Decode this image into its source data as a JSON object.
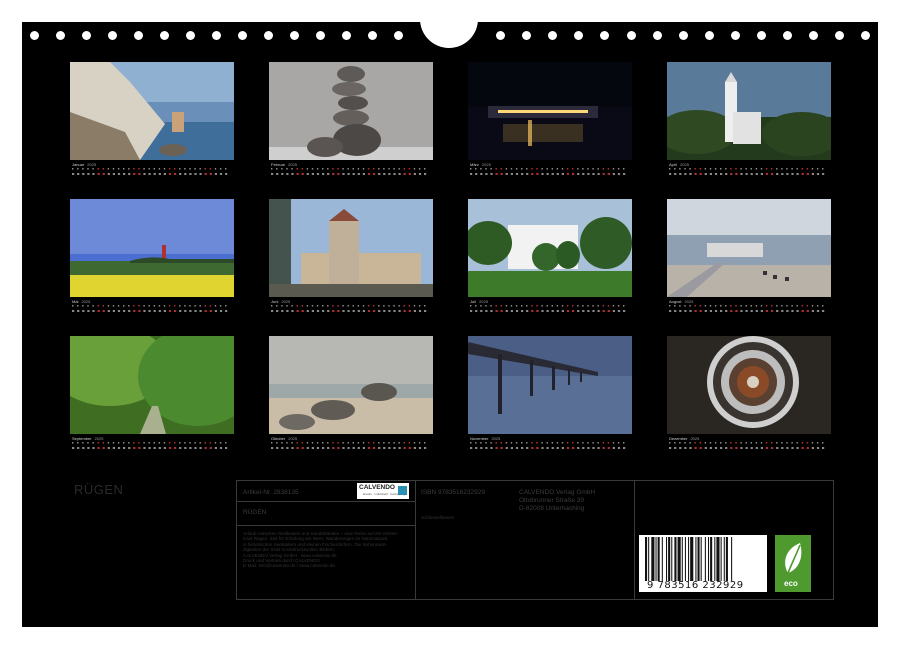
{
  "calendar": {
    "cover_title": "RÜGEN",
    "months": [
      {
        "name": "Januar",
        "year": "2025",
        "scene": "chalk-cliffs"
      },
      {
        "name": "Februar",
        "year": "2025",
        "scene": "stone-stack"
      },
      {
        "name": "März",
        "year": "2025",
        "scene": "night-harbor"
      },
      {
        "name": "April",
        "year": "2025",
        "scene": "white-castle"
      },
      {
        "name": "Mai",
        "year": "2025",
        "scene": "rapeseed-field"
      },
      {
        "name": "Juni",
        "year": "2025",
        "scene": "hotel-building"
      },
      {
        "name": "Juli",
        "year": "2025",
        "scene": "white-villa"
      },
      {
        "name": "August",
        "year": "2025",
        "scene": "pier-beach"
      },
      {
        "name": "September",
        "year": "2025",
        "scene": "green-alley"
      },
      {
        "name": "Oktober",
        "year": "2025",
        "scene": "foggy-beach"
      },
      {
        "name": "November",
        "year": "2025",
        "scene": "long-pier"
      },
      {
        "name": "Dezember",
        "year": "2025",
        "scene": "spiral-staircase"
      }
    ]
  },
  "infobox": {
    "article_no": "Artikel-Nr. 2838135",
    "title": "RÜGEN",
    "isbn": "ISBN 9783516232929",
    "publisher_lines": [
      "CALVENDO Verlag GmbH",
      "Ottobrunner Straße 39",
      "D-82008 Unterhaching"
    ],
    "tag": "Schlüsselfassen",
    "small_text": [
      "Urlaub zwischen Steilküsten und Sandstränden – eine Reise auf die Ostsee-",
      "insel Rügen. Zeit für Erholung am Meer, Wanderungen im Nationalpark,",
      "in historischen Seebädern und kleinen Fischerdörfern. Die Sehenswür-",
      "digkeiten der Insel in eindrucksvollen Bildern.",
      "CALVENDO Verlag GmbH · www.calvendo.de",
      "Druck und Vertrieb durch CALVENDO",
      "E-Mail: info@calvendo.de / www.calvendo.de"
    ],
    "logo": "CALVENDO",
    "logo_sub": "kreativ · individuell · hochwertig",
    "barcode_digits": "9  783516  232929",
    "eco_label": "eco"
  },
  "colors": {
    "sheet": "#000000",
    "weekend": "#b03030",
    "weekday": "#8a8a8a"
  }
}
